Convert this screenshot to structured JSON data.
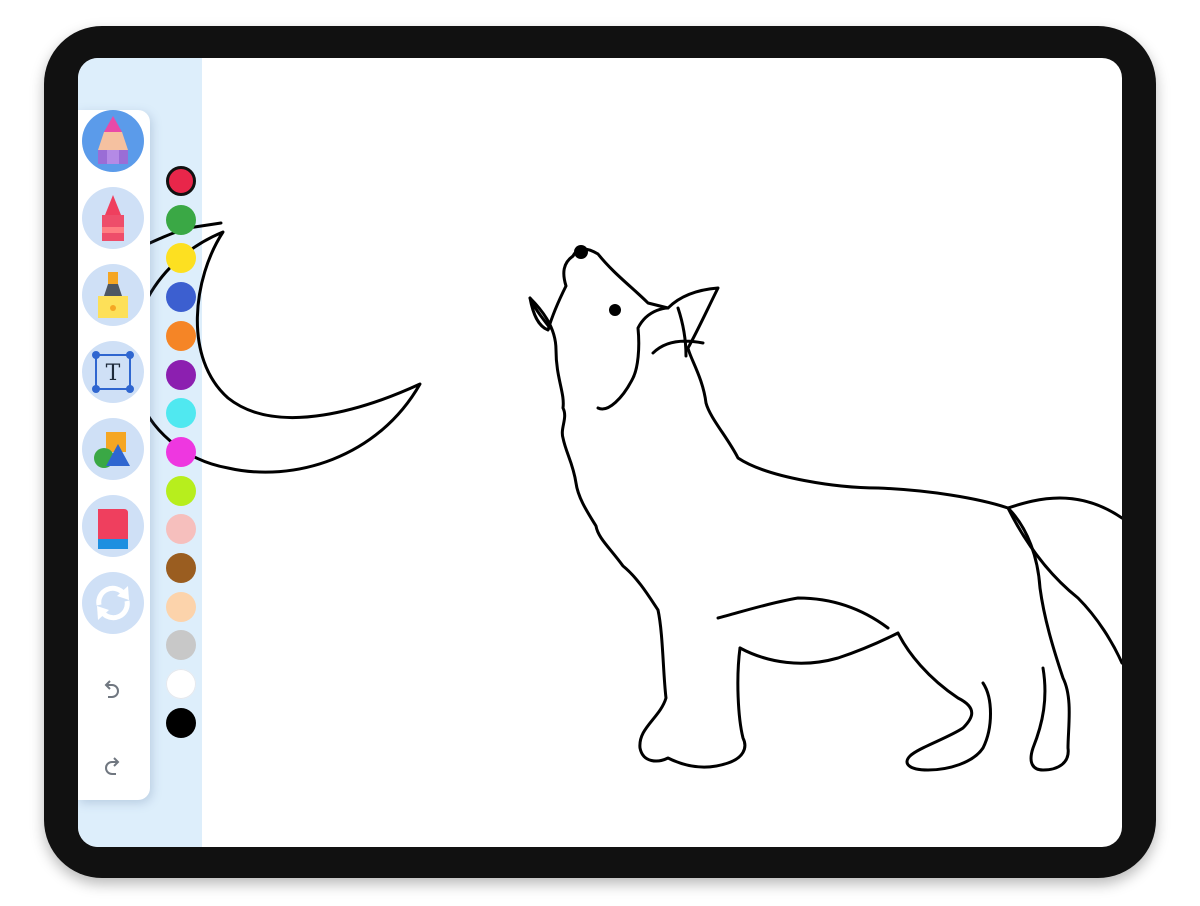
{
  "toolbar": {
    "tools": [
      {
        "name": "pencil-tool",
        "icon": "pencil-icon",
        "active": true
      },
      {
        "name": "crayon-tool",
        "icon": "crayon-icon",
        "active": false
      },
      {
        "name": "marker-tool",
        "icon": "marker-icon",
        "active": false
      },
      {
        "name": "text-tool",
        "icon": "text-icon",
        "active": false
      },
      {
        "name": "shapes-tool",
        "icon": "shapes-icon",
        "active": false
      },
      {
        "name": "eraser-tool",
        "icon": "eraser-icon",
        "active": false
      },
      {
        "name": "reset-tool",
        "icon": "refresh-icon",
        "active": false
      }
    ],
    "undo_icon": "undo-icon",
    "redo_icon": "redo-icon",
    "text_tool_glyph": "T"
  },
  "palette": {
    "selected": "#e8264a",
    "colors": [
      "#e8264a",
      "#3aa845",
      "#fde021",
      "#3c5fd0",
      "#f58526",
      "#8c1fb0",
      "#50e8f0",
      "#ee37e0",
      "#b7ee1d",
      "#f6bfbd",
      "#9a5d20",
      "#fcd3ab",
      "#c8c8c8",
      "#ffffff",
      "#000000"
    ]
  },
  "canvas": {
    "artwork": [
      "crescent-moon",
      "howling-wolf"
    ]
  }
}
